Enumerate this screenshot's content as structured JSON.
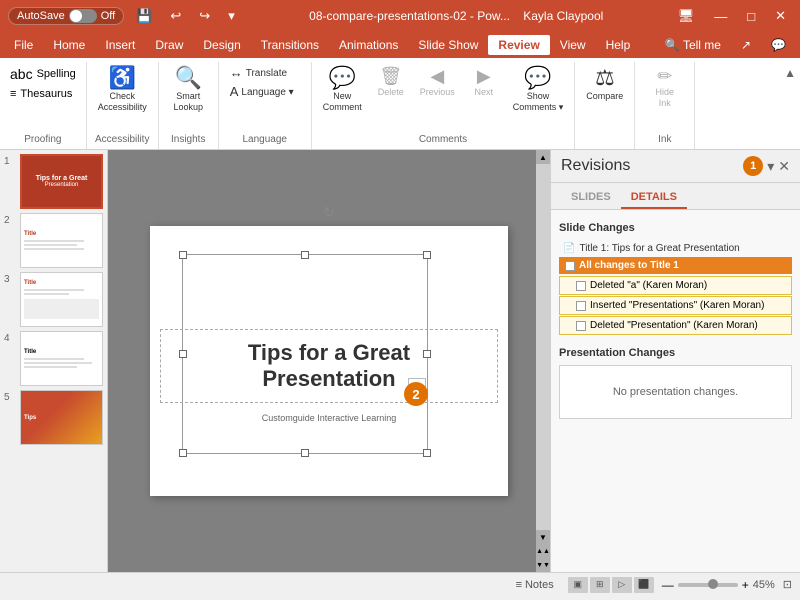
{
  "titleBar": {
    "autosave": "AutoSave",
    "autosaveState": "Off",
    "filename": "08-compare-presentations-02 - Pow...",
    "user": "Kayla Claypool",
    "minimize": "—",
    "maximize": "□",
    "close": "✕"
  },
  "menuBar": {
    "items": [
      "File",
      "Home",
      "Insert",
      "Draw",
      "Design",
      "Transitions",
      "Animations",
      "Slide Show",
      "Review",
      "View",
      "Help"
    ],
    "active": "Review",
    "tellme": "Tell me",
    "share": "↗"
  },
  "ribbon": {
    "groups": [
      {
        "label": "Proofing",
        "items": [
          {
            "icon": "abc✓",
            "label": "Spelling"
          },
          {
            "icon": "≡",
            "label": "Thesaurus"
          }
        ]
      },
      {
        "label": "Accessibility",
        "items": [
          {
            "icon": "♿",
            "label": "Check\nAccessibility"
          }
        ]
      },
      {
        "label": "Insights",
        "items": [
          {
            "icon": "🔍",
            "label": "Smart\nLookup"
          }
        ]
      },
      {
        "label": "Language",
        "items": [
          {
            "icon": "↔",
            "label": "Translate"
          },
          {
            "icon": "A▾",
            "label": "Language"
          }
        ]
      },
      {
        "label": "Comments",
        "items": [
          {
            "icon": "💬+",
            "label": "New\nComment"
          },
          {
            "icon": "🗑",
            "label": "Delete",
            "grayed": true
          },
          {
            "icon": "◀",
            "label": "Previous",
            "grayed": true
          },
          {
            "icon": "▶",
            "label": "Next",
            "grayed": true
          },
          {
            "icon": "💬≡",
            "label": "Show\nComments▾"
          }
        ]
      },
      {
        "label": "",
        "items": [
          {
            "icon": "⚖",
            "label": "Compare"
          }
        ]
      },
      {
        "label": "Ink",
        "items": [
          {
            "icon": "✏🚫",
            "label": "Hide\nInk",
            "grayed": true
          }
        ]
      }
    ]
  },
  "slides": [
    {
      "num": "1",
      "active": true,
      "title": "Title slide"
    },
    {
      "num": "2",
      "active": false,
      "title": "Content slide"
    },
    {
      "num": "3",
      "active": false,
      "title": "Content slide 2"
    },
    {
      "num": "4",
      "active": false,
      "title": "Text slide"
    },
    {
      "num": "5",
      "active": false,
      "title": "Color slide"
    }
  ],
  "canvas": {
    "title": "Tips for a Great Presentation",
    "subtitle": "Customguide Interactive Learning"
  },
  "revisions": {
    "title": "Revisions",
    "tabs": [
      "SLIDES",
      "DETAILS"
    ],
    "activeTab": "DETAILS",
    "slideChanges": {
      "heading": "Slide Changes",
      "items": [
        {
          "icon": "📄",
          "label": "Title 1: Tips for a Great Presentation"
        }
      ],
      "allChanges": "All changes to Title 1",
      "changes": [
        "Deleted \"a\" (Karen Moran)",
        "Inserted \"Presentations\" (Karen Moran)",
        "Deleted \"Presentation\" (Karen Moran)"
      ]
    },
    "presentationChanges": {
      "heading": "Presentation Changes",
      "message": "No presentation changes."
    }
  },
  "statusBar": {
    "notes": "Notes",
    "zoom": "45%",
    "plus": "+",
    "minus": "—"
  }
}
